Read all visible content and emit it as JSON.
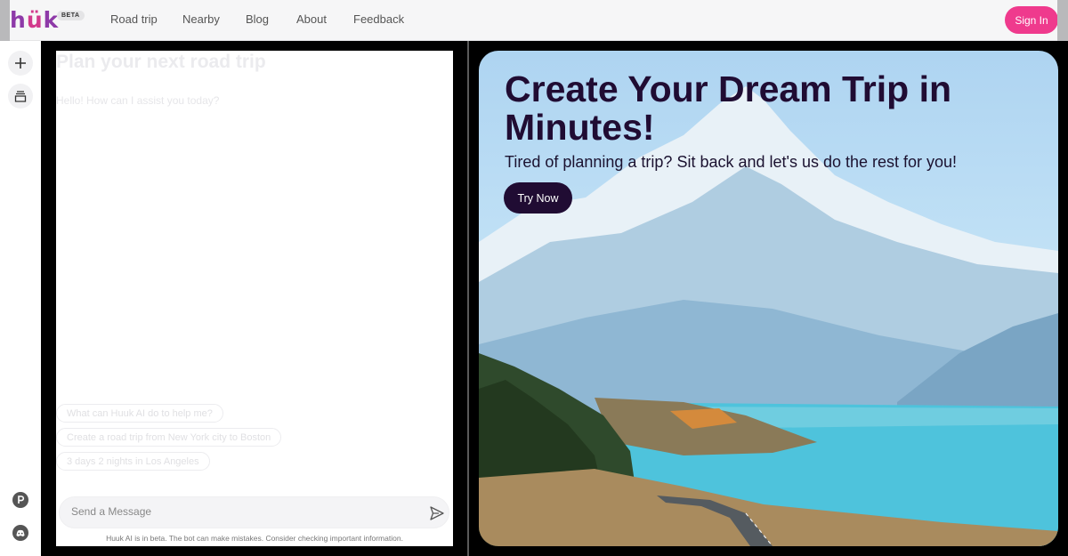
{
  "header": {
    "logo_text": "huk",
    "beta_badge": "BETA",
    "nav": [
      "Road trip",
      "Nearby",
      "Blog",
      "About",
      "Feedback"
    ],
    "signin_label": "Sign In"
  },
  "rail": {
    "icons": [
      "plus-icon",
      "history-icon",
      "parking-icon",
      "discord-icon"
    ]
  },
  "chat": {
    "title": "Plan your next road trip",
    "greeting": "Hello! How can I assist you today?",
    "suggestions": [
      "What can Huuk AI do to help me?",
      "Create a road trip from New York city to Boston",
      "3 days 2 nights in Los Angeles"
    ],
    "input_placeholder": "Send a Message",
    "disclaimer": "Huuk AI is in beta. The bot can make mistakes. Consider checking important information."
  },
  "hero": {
    "title": "Create Your Dream Trip in Minutes!",
    "subtitle": "Tired of planning a trip? Sit back and let's us do the rest for you!",
    "cta_label": "Try Now"
  },
  "colors": {
    "accent_pink": "#ef3a8d",
    "dark_purple": "#200c33",
    "logo_purple": "#8e3aa8"
  }
}
